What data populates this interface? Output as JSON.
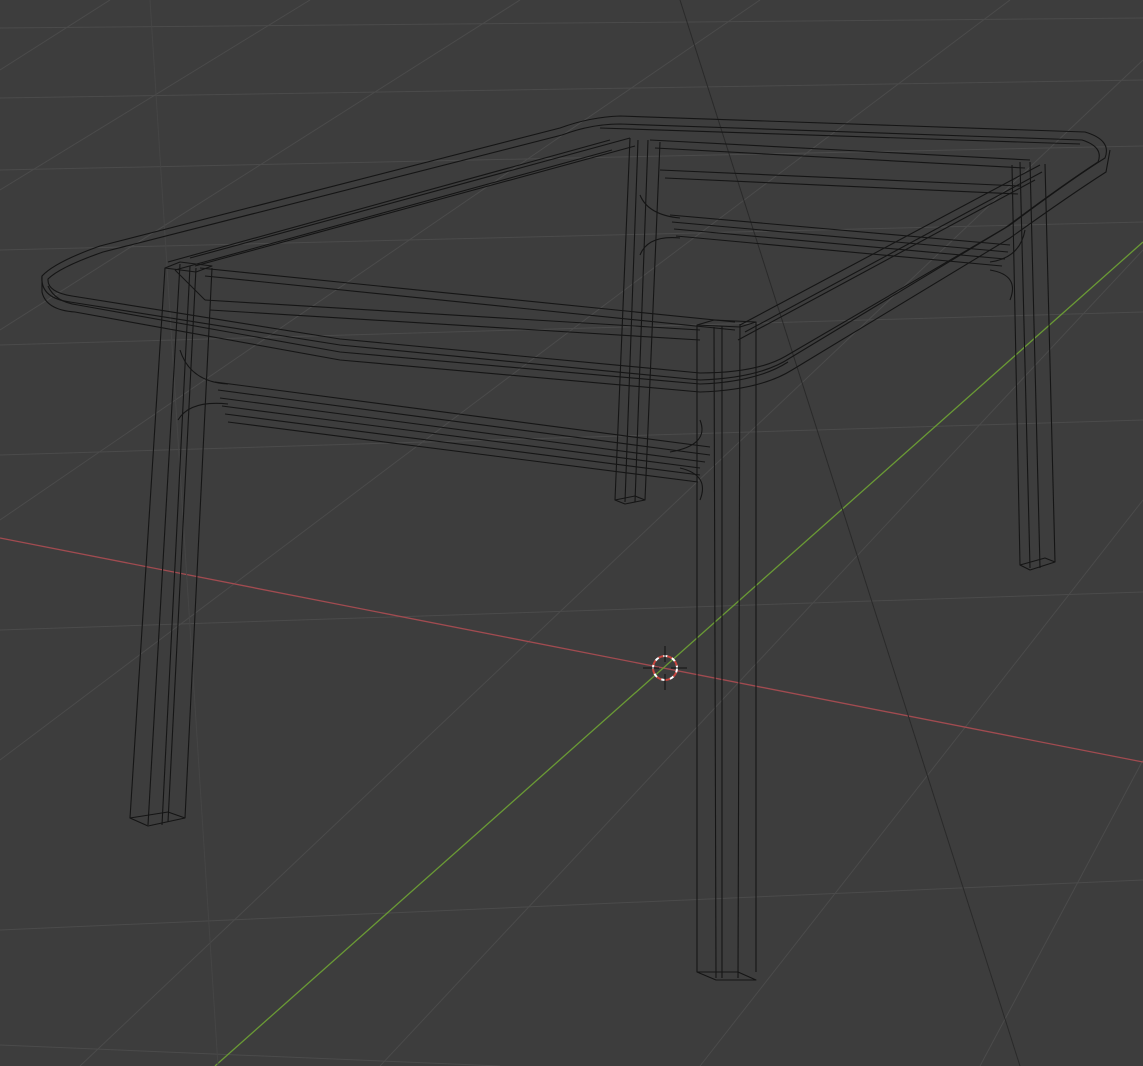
{
  "viewport": {
    "label": "3D Viewport",
    "shading_mode": "wireframe",
    "background_color": "#3d3d3d",
    "grid_color": "#4a4a4a",
    "wire_color": "#141414",
    "x_axis_color": "#a14b50",
    "y_axis_color": "#6a9a35"
  },
  "scene": {
    "object_icon": "table-wireframe",
    "cursor_icon": "3d-cursor-icon"
  }
}
